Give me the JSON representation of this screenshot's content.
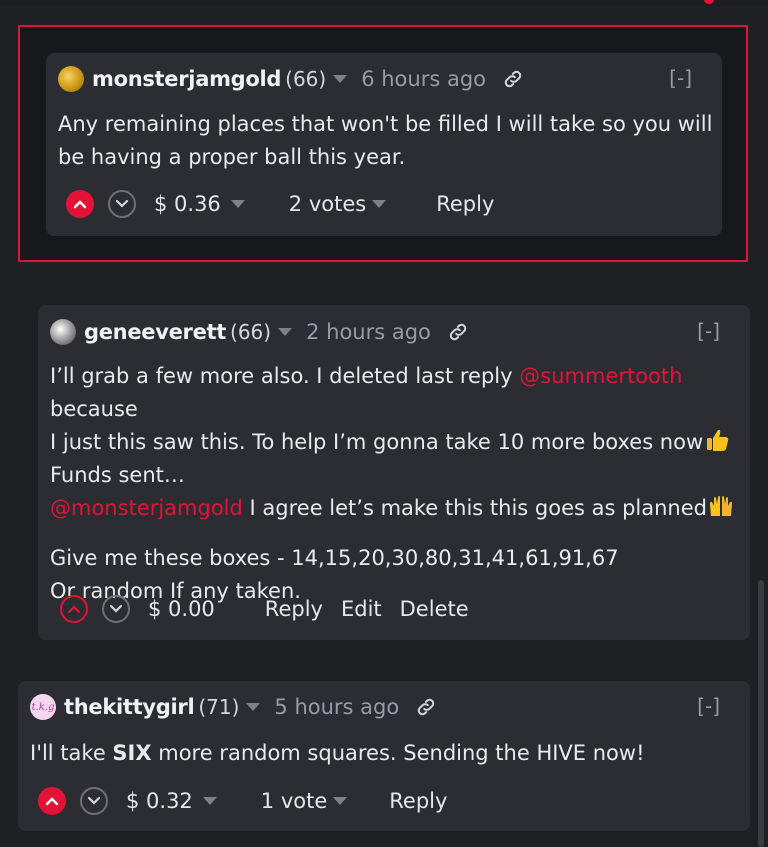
{
  "colors": {
    "accent": "#e31337",
    "card": "#2c2d32",
    "background": "#1f2024"
  },
  "comments": [
    {
      "username": "monsterjamgold",
      "reputation": "(66)",
      "time": "6 hours ago",
      "collapse": "[-]",
      "avatar_icon": "gold-coin-avatar",
      "body_lines": [
        "Any remaining places that won't be filled I will take so you will be having a proper ball this year."
      ],
      "payout": "$ 0.36",
      "votes": "2 votes",
      "reply": "Reply",
      "highlighted": true
    },
    {
      "username": "geneeverett",
      "reputation": "(66)",
      "time": "2 hours ago",
      "collapse": "[-]",
      "avatar_icon": "user-photo-avatar",
      "line1_a": "I’ll grab a few more also. I deleted last reply ",
      "line1_mention": "@summertooth",
      "line1_b": " because",
      "line2": "I just this saw this. To help I’m gonna take 10 more boxes now",
      "line3": "Funds sent…",
      "line4_mention": "@monsterjamgold",
      "line4_b": " I agree let’s make this this goes as planned",
      "line5": "Give me these boxes - 14,15,20,30,80,31,41,61,91,67",
      "line6": "Or random If any taken.",
      "payout": "$ 0.00",
      "reply": "Reply",
      "edit": "Edit",
      "delete": "Delete"
    },
    {
      "username": "thekittygirl",
      "reputation": "(71)",
      "time": "5 hours ago",
      "collapse": "[-]",
      "avatar_icon": "tkg-logo-avatar",
      "avatar_text": "t.k.g",
      "body_a": "I'll take ",
      "body_bold": "SIX",
      "body_b": " more random squares. Sending the HIVE now!",
      "payout": "$ 0.32",
      "votes": "1 vote",
      "reply": "Reply"
    }
  ]
}
